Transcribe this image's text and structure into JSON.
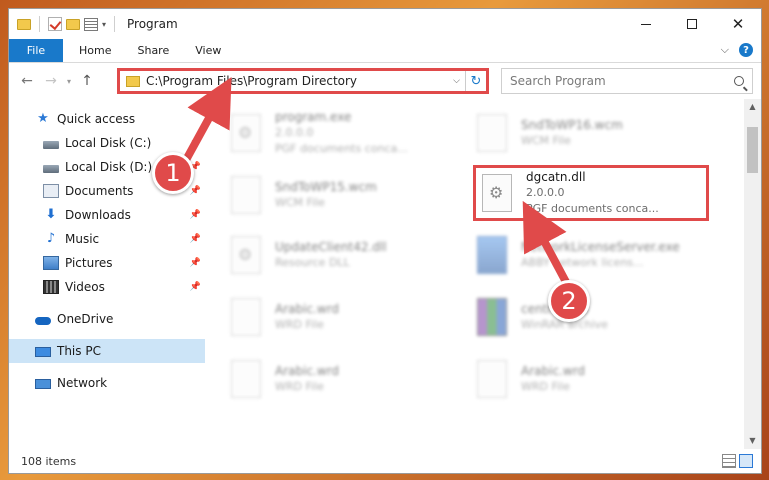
{
  "window": {
    "title": "Program"
  },
  "ribbon": {
    "tabs": [
      {
        "label": "File"
      },
      {
        "label": "Home"
      },
      {
        "label": "Share"
      },
      {
        "label": "View"
      }
    ],
    "help": "?"
  },
  "address": {
    "path": "C:\\Program Files\\Program Directory",
    "search_placeholder": "Search Program"
  },
  "nav": {
    "quick_access": "Quick access",
    "items": [
      {
        "label": "Local Disk (C:)",
        "icon": "disk-icon"
      },
      {
        "label": "Local Disk (D:)",
        "icon": "disk-icon"
      },
      {
        "label": "Documents",
        "icon": "documents-icon"
      },
      {
        "label": "Downloads",
        "icon": "downloads-icon"
      },
      {
        "label": "Music",
        "icon": "music-icon"
      },
      {
        "label": "Pictures",
        "icon": "pictures-icon"
      },
      {
        "label": "Videos",
        "icon": "videos-icon"
      }
    ],
    "onedrive": "OneDrive",
    "this_pc": "This PC",
    "network": "Network"
  },
  "files": [
    {
      "name": "program.exe",
      "sub1": "2.0.0.0",
      "sub2": "PGF documents conca..."
    },
    {
      "name": "SndToWP16.wcm",
      "sub1": "WCM File",
      "sub2": ""
    },
    {
      "name": "SndToWP15.wcm",
      "sub1": "WCM File",
      "sub2": ""
    },
    {
      "name": "dgcatn.dll",
      "sub1": "2.0.0.0",
      "sub2": "PGF documents conca..."
    },
    {
      "name": "UpdateClient42.dll",
      "sub1": "Resource DLL",
      "sub2": ""
    },
    {
      "name": "NetworkLicenseServer.exe",
      "sub1": "ABBY network licens...",
      "sub2": ""
    },
    {
      "name": "Arabic.wrd",
      "sub1": "WRD File",
      "sub2": ""
    },
    {
      "name": "central.cab",
      "sub1": "WinRAR archive",
      "sub2": ""
    },
    {
      "name": "Arabic.wrd",
      "sub1": "WRD File",
      "sub2": ""
    },
    {
      "name": "Arabic.wrd",
      "sub1": "WRD File",
      "sub2": ""
    }
  ],
  "status": {
    "items": "108 items"
  },
  "callouts": {
    "one": "1",
    "two": "2"
  },
  "colors": {
    "accent": "#1979ca",
    "highlight": "#e04a4a",
    "selected": "#cce4f7"
  }
}
